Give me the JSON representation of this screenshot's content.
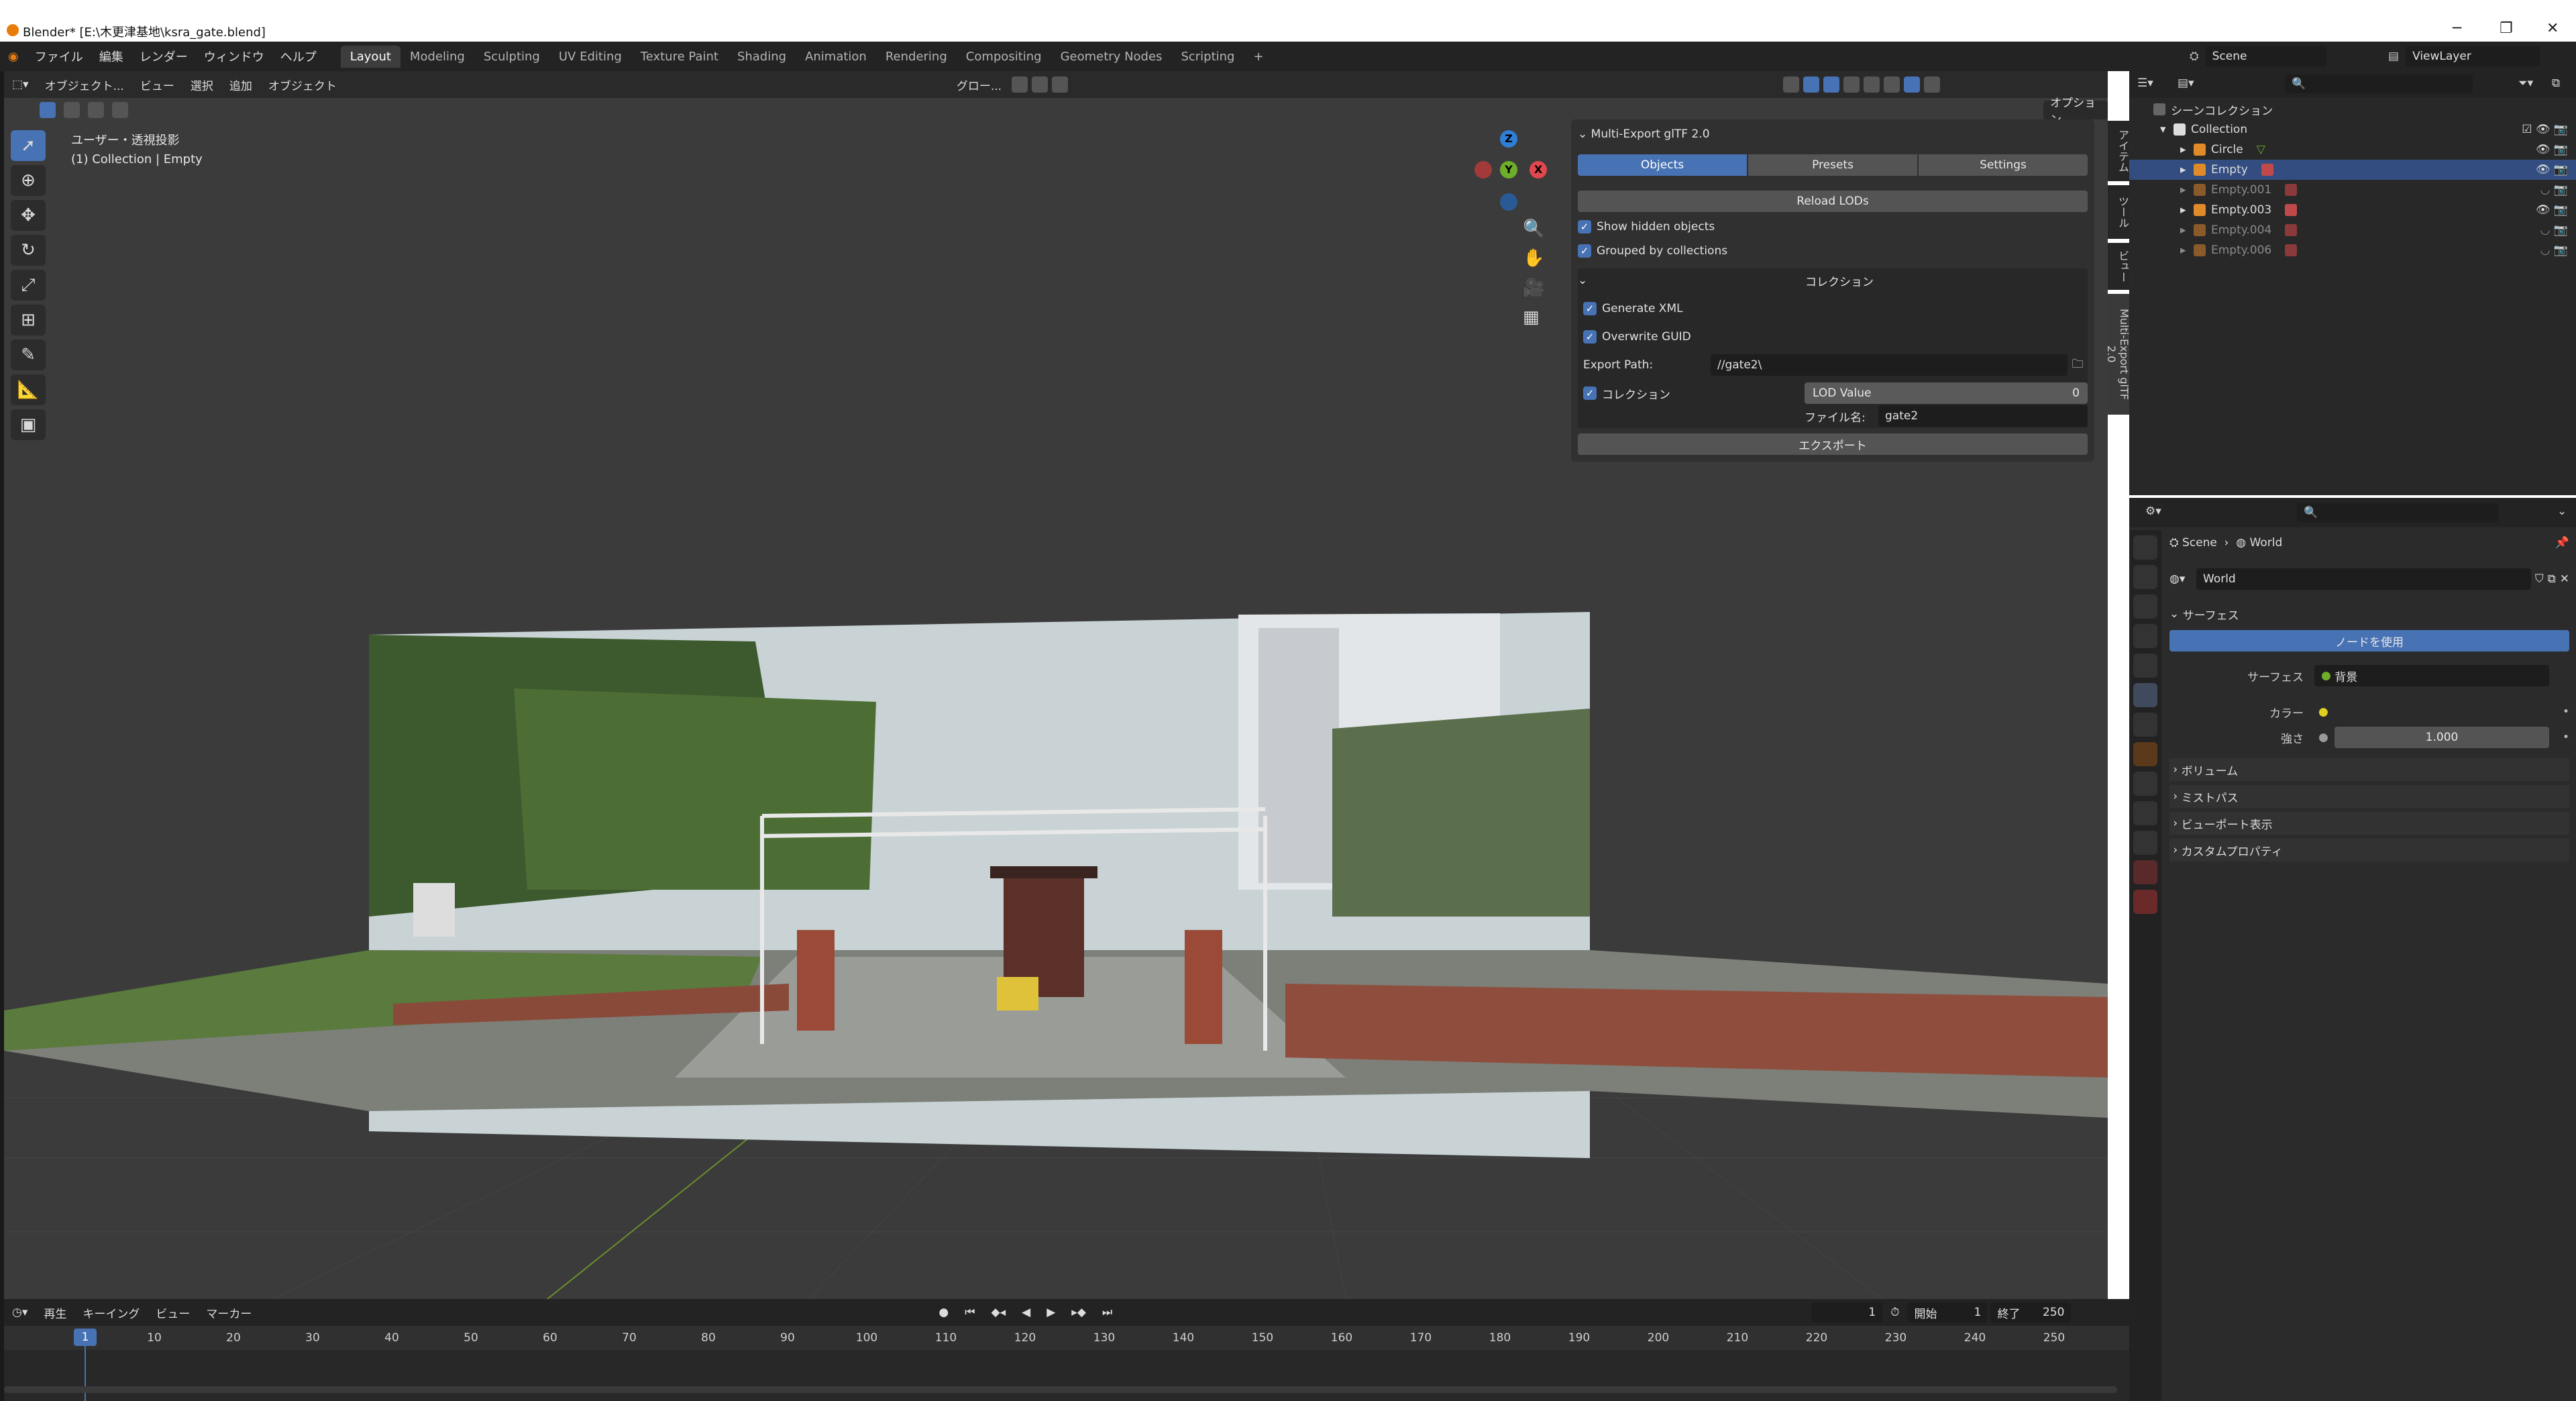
{
  "window": {
    "title": "Blender* [E:\\木更津基地\\ksra_gate.blend]",
    "controls": [
      "─",
      "❐",
      "✕"
    ]
  },
  "topbar": {
    "menus": [
      "ファイル",
      "編集",
      "レンダー",
      "ウィンドウ",
      "ヘルプ"
    ],
    "workspaces": [
      "Layout",
      "Modeling",
      "Sculpting",
      "UV Editing",
      "Texture Paint",
      "Shading",
      "Animation",
      "Rendering",
      "Compositing",
      "Geometry Nodes",
      "Scripting"
    ],
    "active_workspace": "Layout",
    "add_tab": "+",
    "scene": "Scene",
    "view_layer": "ViewLayer"
  },
  "viewport_header": {
    "mode": "オブジェクト...",
    "menus": [
      "ビュー",
      "選択",
      "追加",
      "オブジェクト"
    ],
    "transform_orientation": "グロー...",
    "options": "オプション"
  },
  "viewport_info": {
    "line1": "ユーザー・透視投影",
    "line2": "(1) Collection | Empty"
  },
  "gizmo": {
    "z": "Z",
    "y": "Y",
    "x": "X"
  },
  "npanel": {
    "title": "Multi-Export glTF 2.0",
    "tabs": [
      "Objects",
      "Presets",
      "Settings"
    ],
    "active_tab": "Objects",
    "reload_lods": "Reload LODs",
    "show_hidden": "Show hidden objects",
    "grouped": "Grouped by collections",
    "collection_header": "コレクション",
    "generate_xml": "Generate XML",
    "overwrite_guid": "Overwrite GUID",
    "export_path_label": "Export Path:",
    "export_path_value": "//gate2\\",
    "collection_label": "コレクション",
    "lod_label": "LOD Value",
    "lod_value": "0",
    "filename_label": "ファイル名:",
    "filename_value": "gate2",
    "export_button": "エクスポート",
    "side_tabs": [
      "アイテム",
      "ツール",
      "ビュー",
      "Multi-Export glTF 2.0"
    ]
  },
  "timeline": {
    "menus": [
      "再生",
      "キーイング",
      "ビュー",
      "マーカー"
    ],
    "current_frame": "1",
    "start_label": "開始",
    "start": "1",
    "end_label": "終了",
    "end": "250",
    "ticks": [
      "10",
      "20",
      "30",
      "40",
      "50",
      "60",
      "70",
      "80",
      "90",
      "100",
      "110",
      "120",
      "130",
      "140",
      "150",
      "160",
      "170",
      "180",
      "190",
      "200",
      "210",
      "220",
      "230",
      "240",
      "250"
    ],
    "playhead": "1"
  },
  "outliner": {
    "root": "シーンコレクション",
    "collection": "Collection",
    "items": [
      {
        "name": "Circle",
        "selected": false,
        "dim": false
      },
      {
        "name": "Empty",
        "selected": true,
        "dim": false
      },
      {
        "name": "Empty.001",
        "selected": false,
        "dim": true
      },
      {
        "name": "Empty.003",
        "selected": false,
        "dim": false
      },
      {
        "name": "Empty.004",
        "selected": false,
        "dim": true
      },
      {
        "name": "Empty.006",
        "selected": false,
        "dim": true
      }
    ]
  },
  "properties": {
    "breadcrumb_scene": "Scene",
    "breadcrumb_world": "World",
    "world_name": "World",
    "surface_section": "サーフェス",
    "use_nodes": "ノードを使用",
    "surface_label": "サーフェス",
    "surface_value": "背景",
    "color_label": "カラー",
    "strength_label": "強さ",
    "strength_value": "1.000",
    "sections": [
      "ボリューム",
      "ミストパス",
      "ビューポート表示",
      "カスタムプロパティ"
    ]
  },
  "colors": {
    "accent": "#4772b3",
    "selected_row": "#334d80",
    "bg": "#3b3b3b"
  }
}
